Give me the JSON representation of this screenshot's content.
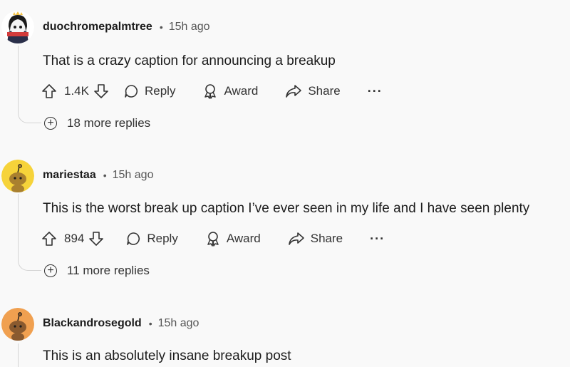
{
  "comments": [
    {
      "username": "duochromepalmtree",
      "time": "15h ago",
      "text": "That is a crazy caption for announcing a breakup",
      "votes": "1.4K",
      "reply_label": "Reply",
      "award_label": "Award",
      "share_label": "Share",
      "more_label": "···",
      "more_replies": "18 more replies",
      "avatar_color": "#ffffff"
    },
    {
      "username": "mariestaa",
      "time": "15h ago",
      "text": "This is the worst break up caption I’ve ever seen in my life and I have seen plenty",
      "votes": "894",
      "reply_label": "Reply",
      "award_label": "Award",
      "share_label": "Share",
      "more_label": "···",
      "more_replies": "11 more replies",
      "avatar_color": "#f6d33a"
    },
    {
      "username": "Blackandrosegold",
      "time": "15h ago",
      "text": "This is an absolutely insane breakup post",
      "avatar_color": "#f0a050"
    }
  ],
  "separator": "•",
  "plus_symbol": "+"
}
